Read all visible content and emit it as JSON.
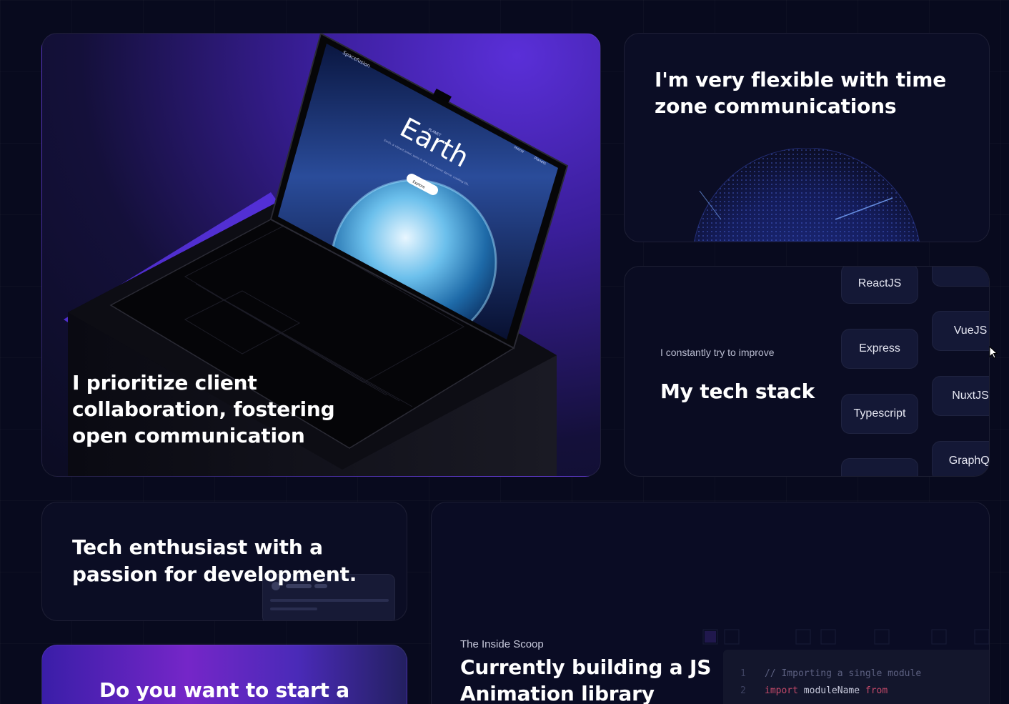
{
  "cards": {
    "collab": {
      "heading": "I prioritize client collaboration, fostering open communication",
      "screen": {
        "brand": "Spacefusion",
        "eyebrow": "PLANET",
        "title": "Earth",
        "tagline": "Earth, a vibrant jewel, spins in the vast cosmic dance, cradling life.",
        "nav": [
          "Home",
          "Planets"
        ],
        "cta": "Explore"
      }
    },
    "timezone": {
      "heading": "I'm very flexible with time zone communications"
    },
    "stack": {
      "intro": "I constantly try to improve",
      "heading": "My tech stack",
      "col1": [
        "ReactJS",
        "Express",
        "Typescript"
      ],
      "col2": [
        "VueJS",
        "NuxtJS",
        "GraphQl"
      ]
    },
    "enthusiast": {
      "heading": "Tech enthusiast with a passion for development."
    },
    "project": {
      "heading": "Do you want to start a"
    },
    "library": {
      "eyebrow": "The Inside Scoop",
      "heading": "Currently building a JS Animation library",
      "code": {
        "line1_num": "1",
        "line1": "// Importing a single module",
        "line2_num": "2",
        "line2_kw": "import",
        "line2_name": "moduleName",
        "line2_from": "from"
      }
    }
  },
  "colors": {
    "background": "#080a1e",
    "accent_purple": "#5a2fd8",
    "card_bg": "#0c0e26",
    "pill_bg": "#141836"
  }
}
